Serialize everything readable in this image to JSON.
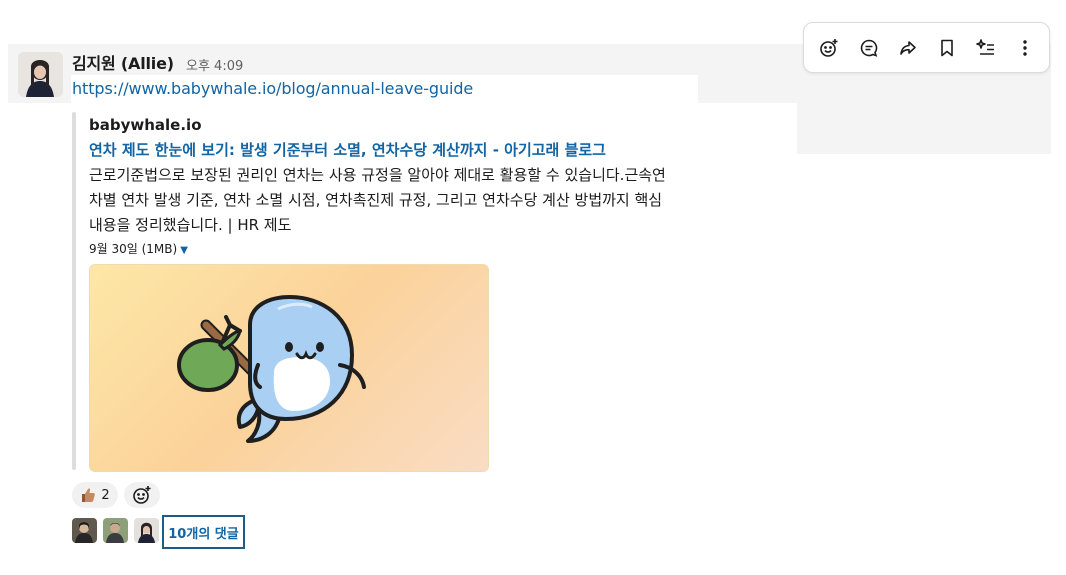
{
  "message": {
    "sender": "김지원 (Allie)",
    "time": "오후 4:09",
    "link": "https://www.babywhale.io/blog/annual-leave-guide"
  },
  "unfurl": {
    "site": "babywhale.io",
    "title": "연차 제도 한눈에 보기: 발생 기준부터 소멸, 연차수당 계산까지 - 아기고래 블로그",
    "description_lines": [
      "근로기준법으로 보장된 권리인 연차는 사용 규정을 알아야 제대로 활용할 수 있습니다.근속연",
      "차별 연차 발생 기준, 연차 소멸 시점, 연차촉진제 규정, 그리고 연차수당 계산 방법까지 핵심",
      "내용을 정리했습니다. | HR 제도"
    ],
    "meta": "9월 30일 (1MB)",
    "image_icon": "baby-whale-with-bindle"
  },
  "reactions": [
    {
      "icon": "thumbs-up-icon",
      "count": "2"
    }
  ],
  "thread": {
    "reply_label": "10개의 댓글",
    "participants": 3
  },
  "toolbar": {
    "icons": [
      "add-reaction-icon",
      "reply-thread-icon",
      "share-icon",
      "bookmark-icon",
      "ai-sparkle-list-icon",
      "more-actions-icon"
    ]
  },
  "colors": {
    "link": "#1264a3",
    "hover_bg": "#f4f4f4",
    "focus_outline": "#1b5d84"
  }
}
